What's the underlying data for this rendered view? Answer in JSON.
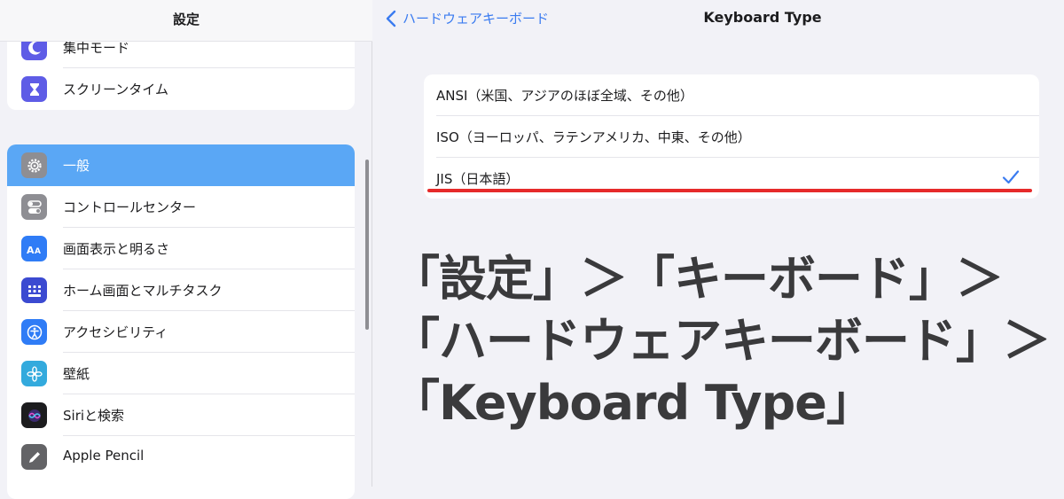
{
  "sidebar": {
    "title": "設定",
    "group1": [
      {
        "label": "集中モード",
        "icon": "moon-icon",
        "color": "#5e5ce6"
      },
      {
        "label": "スクリーンタイム",
        "icon": "hourglass-icon",
        "color": "#5e5ce6"
      }
    ],
    "group2": [
      {
        "label": "一般",
        "icon": "gear-icon",
        "color": "#8e8e93",
        "selected": true
      },
      {
        "label": "コントロールセンター",
        "icon": "toggles-icon",
        "color": "#8e8e93"
      },
      {
        "label": "画面表示と明るさ",
        "icon": "text-size-icon",
        "color": "#2f7cf6"
      },
      {
        "label": "ホーム画面とマルチタスク",
        "icon": "grid-icon",
        "color": "#3b4ad1"
      },
      {
        "label": "アクセシビリティ",
        "icon": "accessibility-icon",
        "color": "#2f7cf6"
      },
      {
        "label": "壁紙",
        "icon": "flower-icon",
        "color": "#33aadd"
      },
      {
        "label": "Siriと検索",
        "icon": "siri-icon",
        "color": "#1c1c1e"
      },
      {
        "label": "Apple Pencil",
        "icon": "pencil-icon",
        "color": "#636366"
      }
    ]
  },
  "detail": {
    "back_label": "ハードウェアキーボード",
    "title": "Keyboard Type",
    "options": [
      {
        "label": "ANSI（米国、アジアのほぼ全域、その他）",
        "checked": false
      },
      {
        "label": "ISO（ヨーロッパ、ラテンアメリカ、中東、その他）",
        "checked": false
      },
      {
        "label": "JIS（日本語）",
        "checked": true
      }
    ],
    "accent_color": "#3a7bf0",
    "highlight_color": "#e62a2a"
  },
  "caption": {
    "line1": "「設定」＞「キーボード」＞",
    "line2": "「ハードウェアキーボード」＞",
    "line3": "「Keyboard Type」"
  }
}
